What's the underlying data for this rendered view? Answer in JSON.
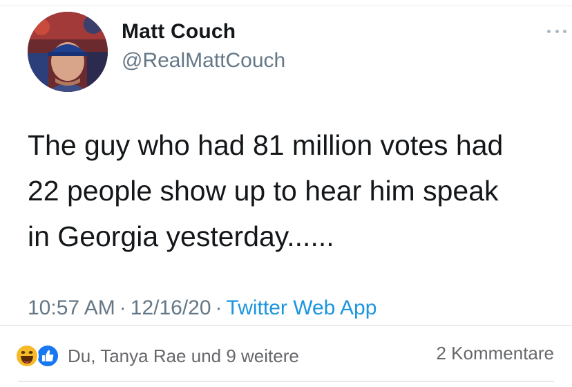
{
  "tweet": {
    "author": {
      "display_name": "Matt Couch",
      "handle": "@RealMattCouch"
    },
    "text": "The guy who had 81 million votes had\n22 people show up to hear him speak\nin Georgia yesterday......",
    "time": "10:57 AM",
    "separator": "·",
    "date": "12/16/20",
    "source": "Twitter Web App",
    "more_icon": "more-dots-icon"
  },
  "facebook_bar": {
    "reaction_icons": [
      "haha-reaction-icon",
      "like-reaction-icon"
    ],
    "reaction_names": "Du, Tanya Rae und 9 weitere",
    "comments": "2 Kommentare"
  },
  "colors": {
    "text": "#14171a",
    "secondary": "#657786",
    "link": "#1b95e0",
    "fb_like": "#1877f2",
    "fb_haha": "#f7b928"
  }
}
